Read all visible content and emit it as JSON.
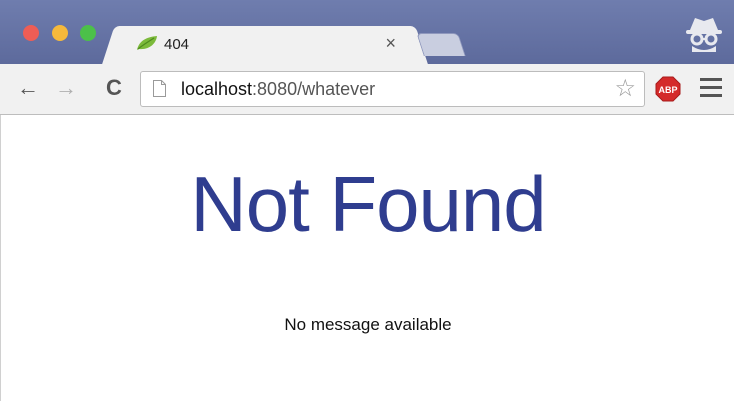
{
  "browser": {
    "tab": {
      "title": "404",
      "close_label": "×"
    },
    "toolbar": {
      "back_icon": "←",
      "forward_icon": "→",
      "reload_icon": "C",
      "url_host": "localhost",
      "url_rest": ":8080/whatever",
      "star_icon": "☆",
      "abp_label": "ABP"
    }
  },
  "page": {
    "heading": "Not Found",
    "message": "No message available",
    "colors": {
      "heading": "#2f3d8f"
    }
  }
}
